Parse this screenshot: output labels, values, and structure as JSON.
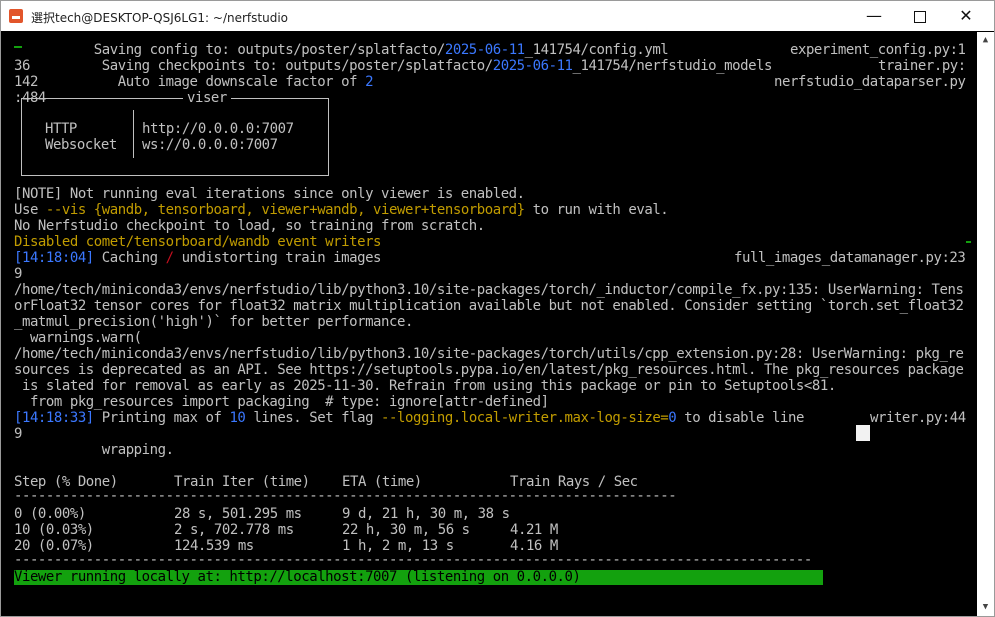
{
  "window": {
    "title": "選択tech@DESKTOP-QSJ6LG1: ~/nerfstudio",
    "minimize_label": "—",
    "close_label": "✕",
    "icon": "terminal-app-icon"
  },
  "terminal": {
    "line1": {
      "text": "          Saving config to: outputs/poster/splatfacto/",
      "date": "2025-06-11",
      "rest": "_141754/config.yml",
      "source": "experiment_config.py:1"
    },
    "line2": {
      "prefix": "36",
      "text": "         Saving checkpoints to: outputs/poster/splatfacto/",
      "date": "2025-06-11",
      "rest": "_141754/nerfstudio_models",
      "source": "trainer.py:"
    },
    "line3": {
      "prefix": "142",
      "text": "          Auto image downscale factor of ",
      "num": "2",
      "source": "nerfstudio_dataparser.py"
    },
    "line4": {
      "prefix": ":484",
      "viser_title": "viser"
    },
    "viser": {
      "http_label": "HTTP",
      "http_value": "http://0.0.0.0:7007",
      "ws_label": "Websocket",
      "ws_value": "ws://0.0.0.0:7007"
    },
    "note": "[NOTE] Not running eval iterations since only viewer is enabled.",
    "use_prefix": "Use ",
    "use_flag": "--vis {wandb, tensorboard, viewer+wandb, viewer+tensorboard}",
    "use_suffix": " to run with eval.",
    "no_checkpoint": "No Nerfstudio checkpoint to load, so training from scratch.",
    "disabled": "Disabled comet/tensorboard/wandb event writers",
    "caching_time": "[14:18:04]",
    "caching_text1": " Caching ",
    "caching_slash": "/",
    "caching_text2": " undistorting train images",
    "caching_source": "full_images_datamanager.py:23",
    "caching_cont": "9",
    "warn1": "/home/tech/miniconda3/envs/nerfstudio/lib/python3.10/site-packages/torch/_inductor/compile_fx.py:135: UserWarning: Tens",
    "warn2": "orFloat32 tensor cores for float32 matrix multiplication available but not enabled. Consider setting `torch.set_float32",
    "warn3": "_matmul_precision('high')` for better performance.",
    "warn4": "  warnings.warn(",
    "warn5": "/home/tech/miniconda3/envs/nerfstudio/lib/python3.10/site-packages/torch/utils/cpp_extension.py:28: UserWarning: pkg_re",
    "warn6": "sources is deprecated as an API. See https://setuptools.pypa.io/en/latest/pkg_resources.html. The pkg_resources package",
    "warn7": " is slated for removal as early as 2025-11-30. Refrain from using this package or pin to Setuptools<81.",
    "warn8": "  from pkg_resources import packaging  # type: ignore[attr-defined]",
    "print_time": "[14:18:33]",
    "print_text1": " Printing max of ",
    "print_num": "10",
    "print_text2": " lines. Set flag ",
    "print_flag": "--logging.local-writer.max-log-size=",
    "print_zero": "0",
    "print_text3": " to disable line",
    "print_source": "writer.py:44",
    "print_cont": "9",
    "wrapping": "           wrapping.",
    "table": {
      "headers": [
        "Step (% Done)",
        "Train Iter (time)",
        "ETA (time)",
        "Train Rays / Sec"
      ],
      "rows": [
        [
          "0 (0.00%)",
          "28 s, 501.295 ms",
          "9 d, 21 h, 30 m, 38 s",
          ""
        ],
        [
          "10 (0.03%)",
          "2 s, 702.778 ms",
          "22 h, 30 m, 56 s",
          "4.21 M"
        ],
        [
          "20 (0.07%)",
          "124.539 ms",
          "1 h, 2 m, 13 s",
          "4.16 M"
        ]
      ]
    },
    "viewer_running": "Viewer running locally at: http://localhost:7007 (listening on 0.0.0.0)"
  },
  "colors": {
    "blue": "#3b78ff",
    "yellow": "#c19c00",
    "green": "#13a10e",
    "text": "#c0c0c0"
  }
}
